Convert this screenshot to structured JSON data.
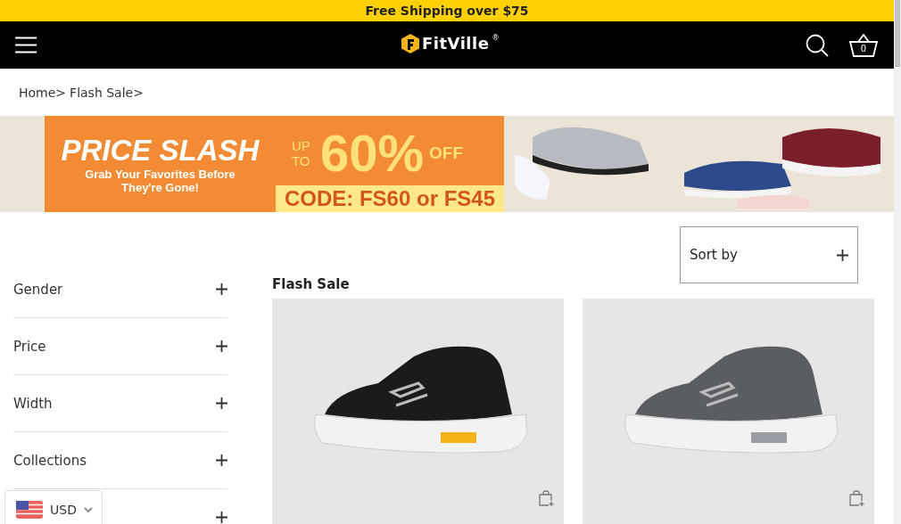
{
  "announcement": "Free Shipping over $75",
  "header": {
    "logo": "FitVille",
    "logo_mark": "®",
    "cart_count": "0"
  },
  "breadcrumb": [
    "Home>",
    "Flash Sale>"
  ],
  "banner": {
    "headline": "PRICE SLASH",
    "subline": "Grab Your Favorites Before They're Gone!",
    "up_to": "UP TO",
    "percent": "60%",
    "off": "OFF",
    "code": "CODE: FS60 or FS45"
  },
  "filters": [
    {
      "label": "Gender",
      "expanded": false
    },
    {
      "label": "Price",
      "expanded": false
    },
    {
      "label": "Width",
      "expanded": false
    },
    {
      "label": "Collections",
      "expanded": false
    },
    {
      "expanded": false
    }
  ],
  "collection_title": "Flash Sale",
  "sort": {
    "label": "Sort by",
    "expanded": false
  },
  "products": [
    {
      "kind": "dark"
    },
    {
      "kind": "grey"
    }
  ],
  "currency": {
    "code": "USD"
  }
}
